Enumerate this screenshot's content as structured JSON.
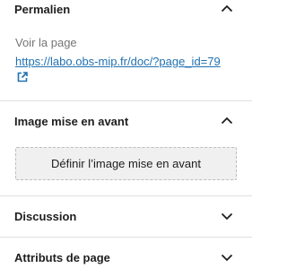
{
  "sections": {
    "permalink": {
      "title": "Permalien",
      "view_label": "Voir la page",
      "url": "https://labo.obs-mip.fr/doc/?page_id=79",
      "toggle_icon": "chevron-up-icon",
      "link_icon": "external-link-icon"
    },
    "featured_image": {
      "title": "Image mise en avant",
      "button_label": "Définir l’image mise en avant",
      "toggle_icon": "chevron-up-icon"
    },
    "discussion": {
      "title": "Discussion",
      "toggle_icon": "chevron-down-icon"
    },
    "page_attributes": {
      "title": "Attributs de page",
      "toggle_icon": "chevron-down-icon"
    }
  },
  "colors": {
    "link": "#2271b1",
    "text": "#1e1e1e",
    "muted": "#757575",
    "divider": "#e0e0e0",
    "button_bg": "#f0f0f0"
  }
}
